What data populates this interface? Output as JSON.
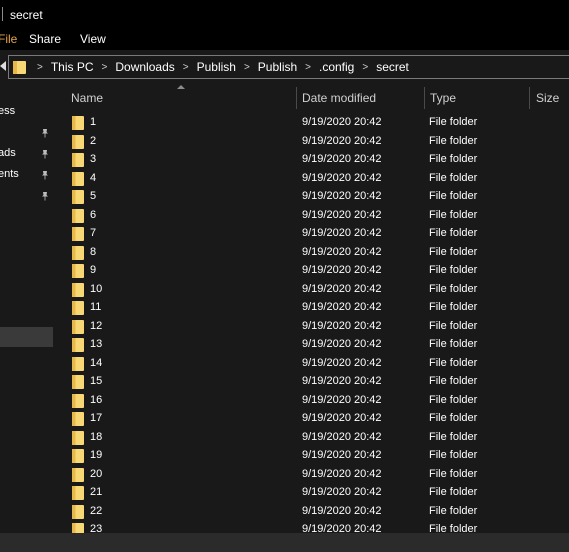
{
  "window": {
    "title": "secret"
  },
  "ribbon": {
    "file_label": "File",
    "share_label": "Share",
    "view_label": "View"
  },
  "address": {
    "crumbs": [
      "This PC",
      "Downloads",
      "Publish",
      "Publish",
      ".config",
      "secret"
    ],
    "separator": ">"
  },
  "nav": {
    "items": [
      "ess",
      "ads",
      "ents"
    ]
  },
  "columns": {
    "name": "Name",
    "date": "Date modified",
    "type": "Type",
    "size": "Size"
  },
  "files": [
    {
      "name": "1",
      "date": "9/19/2020 20:42",
      "type": "File folder"
    },
    {
      "name": "2",
      "date": "9/19/2020 20:42",
      "type": "File folder"
    },
    {
      "name": "3",
      "date": "9/19/2020 20:42",
      "type": "File folder"
    },
    {
      "name": "4",
      "date": "9/19/2020 20:42",
      "type": "File folder"
    },
    {
      "name": "5",
      "date": "9/19/2020 20:42",
      "type": "File folder"
    },
    {
      "name": "6",
      "date": "9/19/2020 20:42",
      "type": "File folder"
    },
    {
      "name": "7",
      "date": "9/19/2020 20:42",
      "type": "File folder"
    },
    {
      "name": "8",
      "date": "9/19/2020 20:42",
      "type": "File folder"
    },
    {
      "name": "9",
      "date": "9/19/2020 20:42",
      "type": "File folder"
    },
    {
      "name": "10",
      "date": "9/19/2020 20:42",
      "type": "File folder"
    },
    {
      "name": "11",
      "date": "9/19/2020 20:42",
      "type": "File folder"
    },
    {
      "name": "12",
      "date": "9/19/2020 20:42",
      "type": "File folder"
    },
    {
      "name": "13",
      "date": "9/19/2020 20:42",
      "type": "File folder"
    },
    {
      "name": "14",
      "date": "9/19/2020 20:42",
      "type": "File folder"
    },
    {
      "name": "15",
      "date": "9/19/2020 20:42",
      "type": "File folder"
    },
    {
      "name": "16",
      "date": "9/19/2020 20:42",
      "type": "File folder"
    },
    {
      "name": "17",
      "date": "9/19/2020 20:42",
      "type": "File folder"
    },
    {
      "name": "18",
      "date": "9/19/2020 20:42",
      "type": "File folder"
    },
    {
      "name": "19",
      "date": "9/19/2020 20:42",
      "type": "File folder"
    },
    {
      "name": "20",
      "date": "9/19/2020 20:42",
      "type": "File folder"
    },
    {
      "name": "21",
      "date": "9/19/2020 20:42",
      "type": "File folder"
    },
    {
      "name": "22",
      "date": "9/19/2020 20:42",
      "type": "File folder"
    },
    {
      "name": "23",
      "date": "9/19/2020 20:42",
      "type": "File folder"
    }
  ],
  "colors": {
    "background": "#191919",
    "titlebar": "#000000",
    "folder": "#f8d775",
    "text": "#ffffff"
  }
}
